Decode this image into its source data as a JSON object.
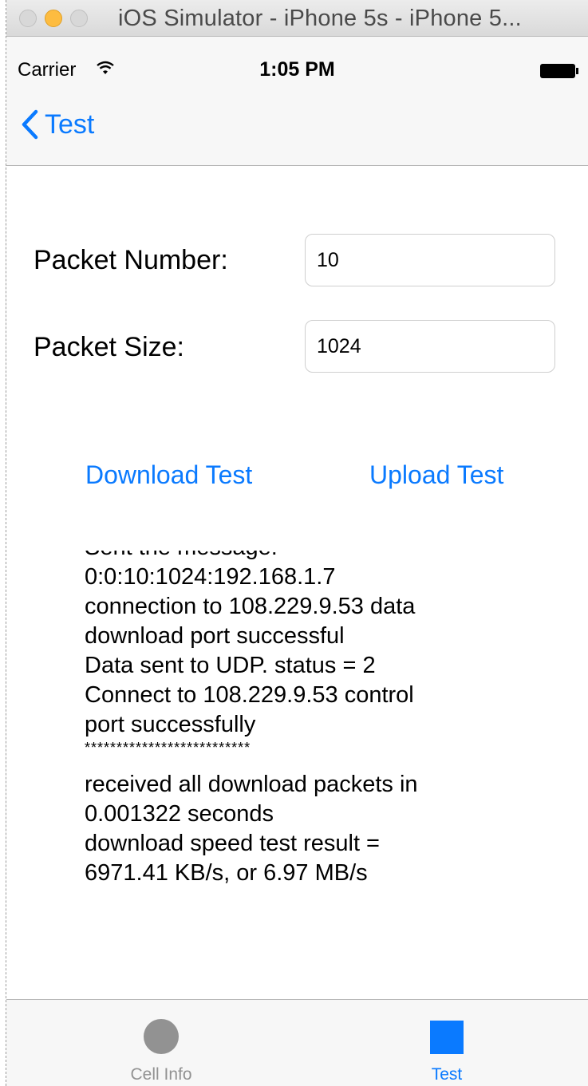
{
  "window": {
    "title": "iOS Simulator - iPhone 5s - iPhone 5..."
  },
  "status_bar": {
    "carrier": "Carrier",
    "time": "1:05 PM",
    "wifi_icon": "wifi-icon",
    "battery_icon": "battery-full-icon"
  },
  "nav_bar": {
    "back_label": "Test",
    "back_icon": "chevron-left-icon"
  },
  "form": {
    "packet_number_label": "Packet Number:",
    "packet_number_value": "10",
    "packet_size_label": "Packet Size:",
    "packet_size_value": "1024"
  },
  "actions": {
    "download_label": "Download Test",
    "upload_label": "Upload Test"
  },
  "log": {
    "lines": [
      "Sent the message:",
      "0:0:10:1024:192.168.1.7",
      "connection to 108.229.9.53 data",
      "download port successful",
      "Data sent to UDP. status = 2",
      "Connect to 108.229.9.53 control",
      "port successfully",
      "**************************",
      "received all download packets in",
      "0.001322 seconds",
      "download speed test result =",
      "6971.41 KB/s, or 6.97 MB/s"
    ]
  },
  "tab_bar": {
    "tabs": [
      {
        "label": "Cell Info",
        "icon": "circle-icon",
        "selected": false
      },
      {
        "label": "Test",
        "icon": "square-icon",
        "selected": true
      }
    ]
  },
  "colors": {
    "accent": "#0a7aff",
    "inactive": "#929292",
    "minimize": "#fdbc40"
  }
}
